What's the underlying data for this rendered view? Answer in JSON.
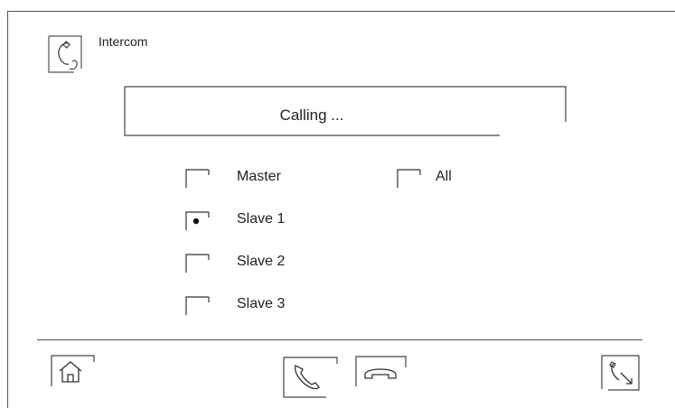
{
  "header": {
    "title": "Intercom",
    "icon": "intercom-handset-icon"
  },
  "status": {
    "text": "Calling ..."
  },
  "options": [
    {
      "label": "Master",
      "selected": false
    },
    {
      "label": "All",
      "selected": false
    },
    {
      "label": "Slave 1",
      "selected": true
    },
    {
      "label": "Slave 2",
      "selected": false
    },
    {
      "label": "Slave 3",
      "selected": false
    }
  ],
  "toolbar": {
    "home": "home-icon",
    "call": "call-handset-icon",
    "hangup": "hang-up-icon",
    "transfer": "transfer-call-icon"
  }
}
